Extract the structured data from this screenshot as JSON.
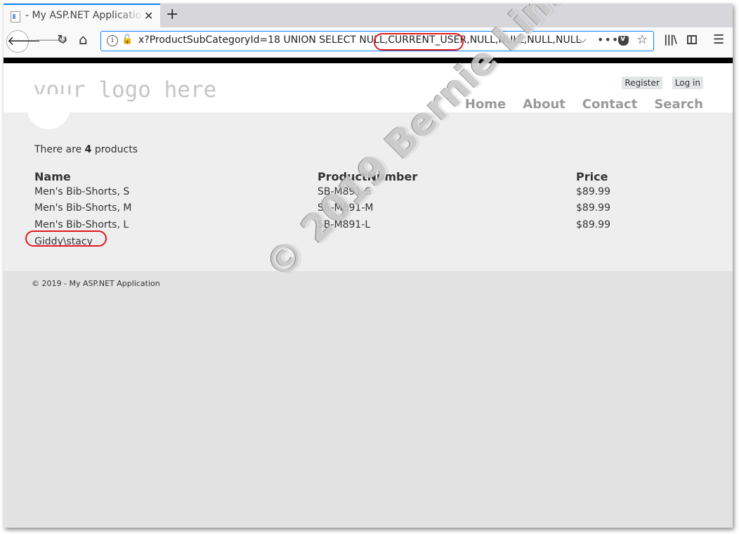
{
  "browser": {
    "tab_title": "- My ASP.NET Applicatio",
    "tab_close": "✕",
    "new_tab": "+",
    "url": "x?ProductSubCategoryId=18 UNION SELECT NULL,CURRENT_USER,NULL,NULL,NULL,NULL,",
    "info_icon": "i"
  },
  "site": {
    "logo": "your logo here",
    "register": "Register",
    "login": "Log in",
    "nav": [
      "Home",
      "About",
      "Contact",
      "Search"
    ]
  },
  "content": {
    "count_prefix": "There are ",
    "count_value": "4",
    "count_suffix": " products",
    "headers": [
      "Name",
      "ProductNumber",
      "Price"
    ],
    "rows": [
      [
        "Men's Bib-Shorts, S",
        "SB-M891-S",
        "$89.99"
      ],
      [
        "Men's Bib-Shorts, M",
        "SB-M891-M",
        "$89.99"
      ],
      [
        "Men's Bib-Shorts, L",
        "SB-M891-L",
        "$89.99"
      ],
      [
        "Giddy\\stacy",
        "",
        ""
      ]
    ]
  },
  "footer": {
    "copyright": "© 2019 - My ASP.NET Application"
  },
  "watermark": "© 2019 Bernie Lim",
  "colors": {
    "highlight": "#e0191e",
    "tab_accent": "#0a84ff"
  }
}
